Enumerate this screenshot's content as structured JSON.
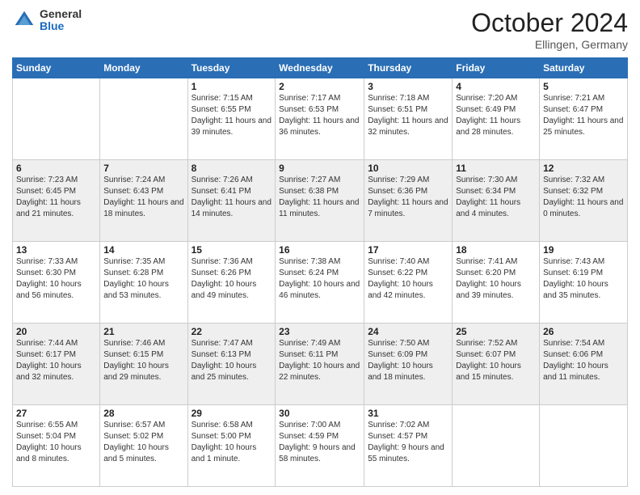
{
  "header": {
    "logo_general": "General",
    "logo_blue": "Blue",
    "month_title": "October 2024",
    "location": "Ellingen, Germany"
  },
  "days_of_week": [
    "Sunday",
    "Monday",
    "Tuesday",
    "Wednesday",
    "Thursday",
    "Friday",
    "Saturday"
  ],
  "weeks": [
    [
      {
        "day": "",
        "sunrise": "",
        "sunset": "",
        "daylight": ""
      },
      {
        "day": "",
        "sunrise": "",
        "sunset": "",
        "daylight": ""
      },
      {
        "day": "1",
        "sunrise": "Sunrise: 7:15 AM",
        "sunset": "Sunset: 6:55 PM",
        "daylight": "Daylight: 11 hours and 39 minutes."
      },
      {
        "day": "2",
        "sunrise": "Sunrise: 7:17 AM",
        "sunset": "Sunset: 6:53 PM",
        "daylight": "Daylight: 11 hours and 36 minutes."
      },
      {
        "day": "3",
        "sunrise": "Sunrise: 7:18 AM",
        "sunset": "Sunset: 6:51 PM",
        "daylight": "Daylight: 11 hours and 32 minutes."
      },
      {
        "day": "4",
        "sunrise": "Sunrise: 7:20 AM",
        "sunset": "Sunset: 6:49 PM",
        "daylight": "Daylight: 11 hours and 28 minutes."
      },
      {
        "day": "5",
        "sunrise": "Sunrise: 7:21 AM",
        "sunset": "Sunset: 6:47 PM",
        "daylight": "Daylight: 11 hours and 25 minutes."
      }
    ],
    [
      {
        "day": "6",
        "sunrise": "Sunrise: 7:23 AM",
        "sunset": "Sunset: 6:45 PM",
        "daylight": "Daylight: 11 hours and 21 minutes."
      },
      {
        "day": "7",
        "sunrise": "Sunrise: 7:24 AM",
        "sunset": "Sunset: 6:43 PM",
        "daylight": "Daylight: 11 hours and 18 minutes."
      },
      {
        "day": "8",
        "sunrise": "Sunrise: 7:26 AM",
        "sunset": "Sunset: 6:41 PM",
        "daylight": "Daylight: 11 hours and 14 minutes."
      },
      {
        "day": "9",
        "sunrise": "Sunrise: 7:27 AM",
        "sunset": "Sunset: 6:38 PM",
        "daylight": "Daylight: 11 hours and 11 minutes."
      },
      {
        "day": "10",
        "sunrise": "Sunrise: 7:29 AM",
        "sunset": "Sunset: 6:36 PM",
        "daylight": "Daylight: 11 hours and 7 minutes."
      },
      {
        "day": "11",
        "sunrise": "Sunrise: 7:30 AM",
        "sunset": "Sunset: 6:34 PM",
        "daylight": "Daylight: 11 hours and 4 minutes."
      },
      {
        "day": "12",
        "sunrise": "Sunrise: 7:32 AM",
        "sunset": "Sunset: 6:32 PM",
        "daylight": "Daylight: 11 hours and 0 minutes."
      }
    ],
    [
      {
        "day": "13",
        "sunrise": "Sunrise: 7:33 AM",
        "sunset": "Sunset: 6:30 PM",
        "daylight": "Daylight: 10 hours and 56 minutes."
      },
      {
        "day": "14",
        "sunrise": "Sunrise: 7:35 AM",
        "sunset": "Sunset: 6:28 PM",
        "daylight": "Daylight: 10 hours and 53 minutes."
      },
      {
        "day": "15",
        "sunrise": "Sunrise: 7:36 AM",
        "sunset": "Sunset: 6:26 PM",
        "daylight": "Daylight: 10 hours and 49 minutes."
      },
      {
        "day": "16",
        "sunrise": "Sunrise: 7:38 AM",
        "sunset": "Sunset: 6:24 PM",
        "daylight": "Daylight: 10 hours and 46 minutes."
      },
      {
        "day": "17",
        "sunrise": "Sunrise: 7:40 AM",
        "sunset": "Sunset: 6:22 PM",
        "daylight": "Daylight: 10 hours and 42 minutes."
      },
      {
        "day": "18",
        "sunrise": "Sunrise: 7:41 AM",
        "sunset": "Sunset: 6:20 PM",
        "daylight": "Daylight: 10 hours and 39 minutes."
      },
      {
        "day": "19",
        "sunrise": "Sunrise: 7:43 AM",
        "sunset": "Sunset: 6:19 PM",
        "daylight": "Daylight: 10 hours and 35 minutes."
      }
    ],
    [
      {
        "day": "20",
        "sunrise": "Sunrise: 7:44 AM",
        "sunset": "Sunset: 6:17 PM",
        "daylight": "Daylight: 10 hours and 32 minutes."
      },
      {
        "day": "21",
        "sunrise": "Sunrise: 7:46 AM",
        "sunset": "Sunset: 6:15 PM",
        "daylight": "Daylight: 10 hours and 29 minutes."
      },
      {
        "day": "22",
        "sunrise": "Sunrise: 7:47 AM",
        "sunset": "Sunset: 6:13 PM",
        "daylight": "Daylight: 10 hours and 25 minutes."
      },
      {
        "day": "23",
        "sunrise": "Sunrise: 7:49 AM",
        "sunset": "Sunset: 6:11 PM",
        "daylight": "Daylight: 10 hours and 22 minutes."
      },
      {
        "day": "24",
        "sunrise": "Sunrise: 7:50 AM",
        "sunset": "Sunset: 6:09 PM",
        "daylight": "Daylight: 10 hours and 18 minutes."
      },
      {
        "day": "25",
        "sunrise": "Sunrise: 7:52 AM",
        "sunset": "Sunset: 6:07 PM",
        "daylight": "Daylight: 10 hours and 15 minutes."
      },
      {
        "day": "26",
        "sunrise": "Sunrise: 7:54 AM",
        "sunset": "Sunset: 6:06 PM",
        "daylight": "Daylight: 10 hours and 11 minutes."
      }
    ],
    [
      {
        "day": "27",
        "sunrise": "Sunrise: 6:55 AM",
        "sunset": "Sunset: 5:04 PM",
        "daylight": "Daylight: 10 hours and 8 minutes."
      },
      {
        "day": "28",
        "sunrise": "Sunrise: 6:57 AM",
        "sunset": "Sunset: 5:02 PM",
        "daylight": "Daylight: 10 hours and 5 minutes."
      },
      {
        "day": "29",
        "sunrise": "Sunrise: 6:58 AM",
        "sunset": "Sunset: 5:00 PM",
        "daylight": "Daylight: 10 hours and 1 minute."
      },
      {
        "day": "30",
        "sunrise": "Sunrise: 7:00 AM",
        "sunset": "Sunset: 4:59 PM",
        "daylight": "Daylight: 9 hours and 58 minutes."
      },
      {
        "day": "31",
        "sunrise": "Sunrise: 7:02 AM",
        "sunset": "Sunset: 4:57 PM",
        "daylight": "Daylight: 9 hours and 55 minutes."
      },
      {
        "day": "",
        "sunrise": "",
        "sunset": "",
        "daylight": ""
      },
      {
        "day": "",
        "sunrise": "",
        "sunset": "",
        "daylight": ""
      }
    ]
  ]
}
